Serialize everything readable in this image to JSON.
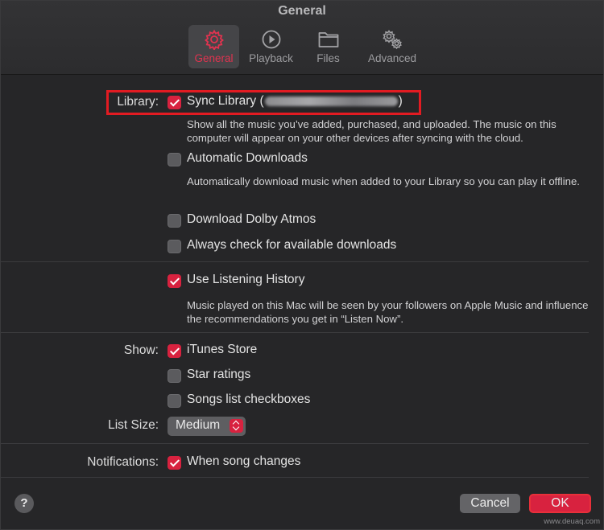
{
  "window": {
    "title": "General"
  },
  "tabs": [
    {
      "label": "General",
      "icon": "gear-icon",
      "selected": true
    },
    {
      "label": "Playback",
      "icon": "play-circle-icon",
      "selected": false
    },
    {
      "label": "Files",
      "icon": "folder-icon",
      "selected": false
    },
    {
      "label": "Advanced",
      "icon": "gears-icon",
      "selected": false
    }
  ],
  "library": {
    "label": "Library:",
    "sync": {
      "label_prefix": "Sync Library (",
      "label_suffix": ")",
      "checked": true,
      "desc": "Show all the music you’ve added, purchased, and uploaded. The music on this computer will appear on your other devices after syncing with the cloud."
    },
    "auto_downloads": {
      "label": "Automatic Downloads",
      "checked": false,
      "desc": "Automatically download music when added to your Library so you can play it offline."
    },
    "dolby": {
      "label": "Download Dolby Atmos",
      "checked": false
    },
    "always_check": {
      "label": "Always check for available downloads",
      "checked": false
    }
  },
  "history": {
    "label": "Use Listening History",
    "checked": true,
    "desc": "Music played on this Mac will be seen by your followers on Apple Music and influence the recommendations you get in “Listen Now”."
  },
  "show": {
    "label": "Show:",
    "itunes": {
      "label": "iTunes Store",
      "checked": true
    },
    "stars": {
      "label": "Star ratings",
      "checked": false
    },
    "songs": {
      "label": "Songs list checkboxes",
      "checked": false
    }
  },
  "list_size": {
    "label": "List Size:",
    "value": "Medium"
  },
  "notifications": {
    "label": "Notifications:",
    "option": "When song changes",
    "checked": true
  },
  "footer": {
    "help": "?",
    "cancel": "Cancel",
    "ok": "OK"
  },
  "watermark": "www.deuaq.com",
  "colors": {
    "accent": "#d8223f",
    "highlight_box": "#e21b22"
  }
}
